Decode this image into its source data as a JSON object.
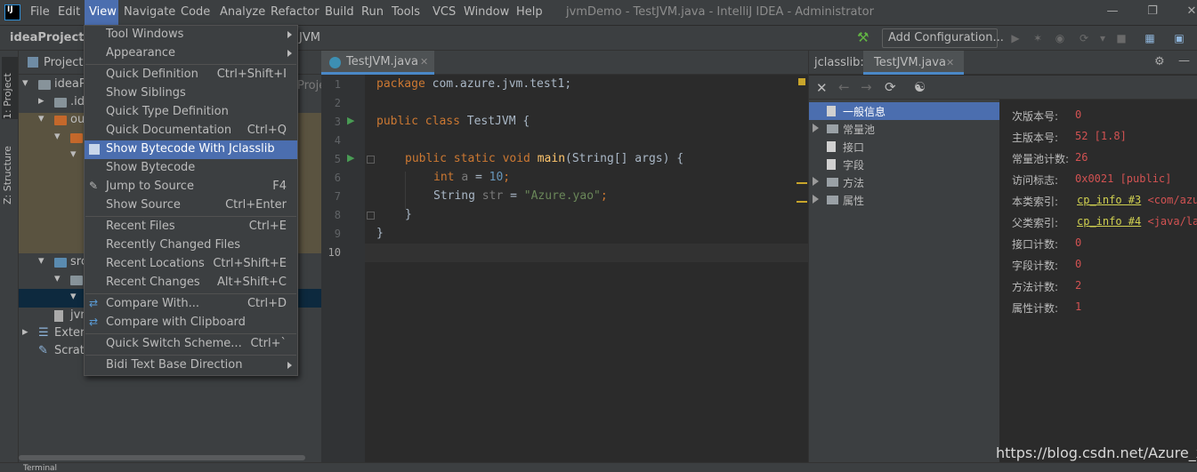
{
  "app": {
    "window_title": "jvmDemo - TestJVM.java - IntelliJ IDEA - Administrator",
    "logo_text": "IJ"
  },
  "menubar": [
    "File",
    "Edit",
    "View",
    "Navigate",
    "Code",
    "Analyze",
    "Refactor",
    "Build",
    "Run",
    "Tools",
    "VCS",
    "Window",
    "Help"
  ],
  "navbar": {
    "project": "ideaProject",
    "crumb_tail": "JVM",
    "add_configuration": "Add Configuration..."
  },
  "view_menu": [
    {
      "label": "Tool Windows",
      "shortcut": "",
      "submenu": true,
      "icon": ""
    },
    {
      "label": "Appearance",
      "shortcut": "",
      "submenu": true,
      "icon": ""
    },
    {
      "label": "Quick Definition",
      "shortcut": "Ctrl+Shift+I",
      "submenu": false,
      "icon": ""
    },
    {
      "label": "Show Siblings",
      "shortcut": "",
      "submenu": false,
      "icon": ""
    },
    {
      "label": "Quick Type Definition",
      "shortcut": "",
      "submenu": false,
      "icon": ""
    },
    {
      "label": "Quick Documentation",
      "shortcut": "Ctrl+Q",
      "submenu": false,
      "icon": ""
    },
    {
      "label": "Show Bytecode With Jclasslib",
      "shortcut": "",
      "submenu": false,
      "icon": "bytecode-icon",
      "highlighted": true
    },
    {
      "label": "Show Bytecode",
      "shortcut": "",
      "submenu": false,
      "icon": ""
    },
    {
      "label": "Jump to Source",
      "shortcut": "F4",
      "submenu": false,
      "icon": "pencil-icon"
    },
    {
      "label": "Show Source",
      "shortcut": "Ctrl+Enter",
      "submenu": false,
      "icon": ""
    },
    {
      "label": "Recent Files",
      "shortcut": "Ctrl+E",
      "submenu": false,
      "icon": ""
    },
    {
      "label": "Recently Changed Files",
      "shortcut": "",
      "submenu": false,
      "icon": ""
    },
    {
      "label": "Recent Locations",
      "shortcut": "Ctrl+Shift+E",
      "submenu": false,
      "icon": ""
    },
    {
      "label": "Recent Changes",
      "shortcut": "Alt+Shift+C",
      "submenu": false,
      "icon": ""
    },
    {
      "label": "Compare With...",
      "shortcut": "Ctrl+D",
      "submenu": false,
      "icon": "compare-icon"
    },
    {
      "label": "Compare with Clipboard",
      "shortcut": "",
      "submenu": false,
      "icon": "compare-icon"
    },
    {
      "label": "Quick Switch Scheme...",
      "shortcut": "Ctrl+`",
      "submenu": false,
      "icon": ""
    },
    {
      "label": "Bidi Text Base Direction",
      "shortcut": "",
      "submenu": true,
      "icon": ""
    }
  ],
  "left_strip": {
    "project_tab": "1: Project",
    "structure_tab": "Z: Structure"
  },
  "project_panel": {
    "title": "Project",
    "tree": [
      "ideaPr",
      ".ide",
      "ou",
      "",
      "",
      "src",
      "",
      "",
      "jvm",
      "Extern",
      "Scrato"
    ]
  },
  "editor": {
    "tab": "TestJVM.java",
    "peek_label": "Proje",
    "line_numbers": [
      "1",
      "2",
      "3",
      "4",
      "5",
      "6",
      "7",
      "8",
      "9",
      "10"
    ],
    "code": {
      "l1_kw": "package",
      "l1_rest": " com.azure.jvm.test1;",
      "l3_kw": "public class",
      "l3_rest": " TestJVM {",
      "l5_kw": "public static void",
      "l5_fn": "main",
      "l5_rest": "(String[] args) {",
      "l6_kw": "int",
      "l6_var": "a",
      "l6_eq": " = ",
      "l6_num": "10",
      "l6_end": ";",
      "l7_type": "String ",
      "l7_var": "str",
      "l7_eq": " = ",
      "l7_str": "\"Azure.yao\"",
      "l7_end": ";",
      "l8": "}",
      "l9": "}"
    }
  },
  "jclasslib": {
    "title": "jclasslib:",
    "tab": "TestJVM.java",
    "tree": [
      {
        "label": "一般信息",
        "expandable": false,
        "selected": true
      },
      {
        "label": "常量池",
        "expandable": true,
        "selected": false
      },
      {
        "label": "接口",
        "expandable": false,
        "selected": false
      },
      {
        "label": "字段",
        "expandable": false,
        "selected": false
      },
      {
        "label": "方法",
        "expandable": true,
        "selected": false
      },
      {
        "label": "属性",
        "expandable": true,
        "selected": false
      }
    ],
    "info": [
      {
        "key": "次版本号:",
        "value": "0"
      },
      {
        "key": "主版本号:",
        "value": "52 [1.8]"
      },
      {
        "key": "常量池计数:",
        "value": "26"
      },
      {
        "key": "访问标志:",
        "value": "0x0021 [public]"
      },
      {
        "key": "本类索引:",
        "link": "cp_info #3",
        "rest": "<com/azur"
      },
      {
        "key": "父类索引:",
        "link": "cp_info #4",
        "rest": "<java/lan"
      },
      {
        "key": "接口计数:",
        "value": "0"
      },
      {
        "key": "字段计数:",
        "value": "0"
      },
      {
        "key": "方法计数:",
        "value": "2"
      },
      {
        "key": "属性计数:",
        "value": "1"
      }
    ]
  },
  "watermark": "https://blog.csdn.net/Azure_xw",
  "bottom": {
    "label": "Terminal"
  },
  "colors": {
    "accent": "#4b6eaf",
    "background": "#2b2b2b",
    "panel": "#3c3f41"
  }
}
